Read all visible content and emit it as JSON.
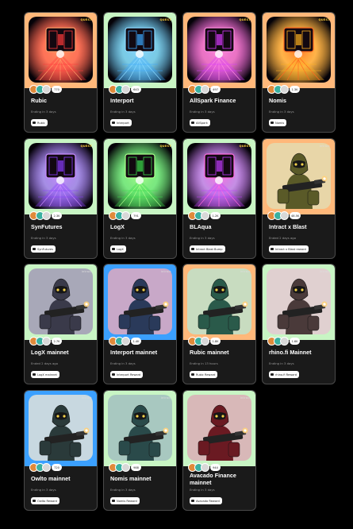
{
  "cards": [
    {
      "title": "Rubic",
      "status": "Ending in 3 days",
      "reward": "Rubic",
      "count": "770",
      "border": "#ffb87a",
      "art": "pad",
      "glow": "#ff3b3b",
      "glow2": "#ff9a66",
      "tag": "QUEST",
      "tag_color": "yellow"
    },
    {
      "title": "Interport",
      "status": "Ending in 3 days",
      "reward": "Interport",
      "count": "643",
      "border": "#c8f5c4",
      "art": "pad",
      "glow": "#3ba8ff",
      "glow2": "#8ad8ff",
      "tag": "QUEST",
      "tag_color": "yellow"
    },
    {
      "title": "AllSpark Finance",
      "status": "Ending in 3 days",
      "reward": "AllSpark",
      "count": "497",
      "border": "#ffb87a",
      "art": "pad",
      "glow": "#d93bff",
      "glow2": "#ff8adf",
      "tag": "QUEST",
      "tag_color": "yellow"
    },
    {
      "title": "Nomis",
      "status": "Ending in 3 days",
      "reward": "Nomis",
      "count": "1.3K",
      "border": "#ffb87a",
      "art": "pad",
      "glow": "#ffb020",
      "glow2": "#ff6a20",
      "tag": "QUEST",
      "tag_color": "yellow"
    },
    {
      "title": "SynFutures",
      "status": "Ending in 3 days",
      "reward": "SynFutures",
      "count": "2.3K",
      "border": "#c8f5c4",
      "art": "pad",
      "glow": "#8a3bff",
      "glow2": "#c88aff",
      "tag": "QUEST",
      "tag_color": "yellow"
    },
    {
      "title": "LogX",
      "status": "Ending in 3 days",
      "reward": "LogX",
      "count": "791",
      "border": "#c8f5c4",
      "art": "pad",
      "glow": "#3bdc4a",
      "glow2": "#a8ff8a",
      "tag": "QUEST",
      "tag_color": "yellow"
    },
    {
      "title": "BLAqua",
      "status": "Ending in 3 days",
      "reward": "Intract Blast Bump",
      "count": "1.2K",
      "border": "#c8f5c4",
      "art": "pad",
      "glow": "#c23bff",
      "glow2": "#ff6adf",
      "tag": "QUEST",
      "tag_color": "yellow"
    },
    {
      "title": "Intract x Blast",
      "status": "Ended 2 days ago",
      "reward": "Intract x Blast reward",
      "count": "48.5K",
      "border": "#ffb87a",
      "art": "soldier",
      "bg": "#e8d6a8",
      "suit": "#5a5a28",
      "tag": "intract",
      "tag_color": "white"
    },
    {
      "title": "LogX mainnet",
      "status": "Ended 2 days ago",
      "reward": "LogX mainnet",
      "count": "2.7K",
      "border": "#c8f5c4",
      "art": "soldier",
      "bg": "#a8a8b8",
      "suit": "#3a3a4a",
      "tag": "intract",
      "tag_color": "white"
    },
    {
      "title": "Interport mainnet",
      "status": "Ending in 3 days",
      "reward": "Interport Reward",
      "count": "1.4K",
      "border": "#3ba0ff",
      "art": "soldier",
      "bg": "#c8a8c8",
      "suit": "#2a3a5a",
      "tag": "intract",
      "tag_color": "white"
    },
    {
      "title": "Rubic mainnet",
      "status": "Ending in 13 hours",
      "reward": "Rubic Reward",
      "count": "1.8K",
      "border": "#ffb87a",
      "art": "soldier",
      "bg": "#c8dcc0",
      "suit": "#2a5a4a",
      "tag": "intract",
      "tag_color": "white"
    },
    {
      "title": "rhino.fi Mainnet",
      "status": "Ending in 3 days",
      "reward": "rhino.fi Reward",
      "count": "1.6K",
      "border": "#c8f5c4",
      "art": "soldier",
      "bg": "#e0d0d0",
      "suit": "#4a3a3a",
      "tag": "intract",
      "tag_color": "white"
    },
    {
      "title": "Owlto mainnet",
      "status": "Ending in 3 days",
      "reward": "Owlto Reward",
      "count": "720",
      "border": "#3ba0ff",
      "art": "soldier",
      "bg": "#c8d8e0",
      "suit": "#2a3a3a",
      "tag": "intract",
      "tag_color": "white"
    },
    {
      "title": "Nomis mainnet",
      "status": "Ending in 3 days",
      "reward": "Nomis Reward",
      "count": "988",
      "border": "#c8f5c4",
      "art": "soldier",
      "bg": "#a8c8c0",
      "suit": "#2a4a4a",
      "tag": "intract",
      "tag_color": "white"
    },
    {
      "title": "Avacado Finance mainnet",
      "status": "Ending in 3 days",
      "reward": "Avacado Reward",
      "count": "944",
      "border": "#c8f5c4",
      "art": "soldier",
      "bg": "#d8b8b8",
      "suit": "#6a1a22",
      "tag": "intract",
      "tag_color": "white"
    }
  ]
}
